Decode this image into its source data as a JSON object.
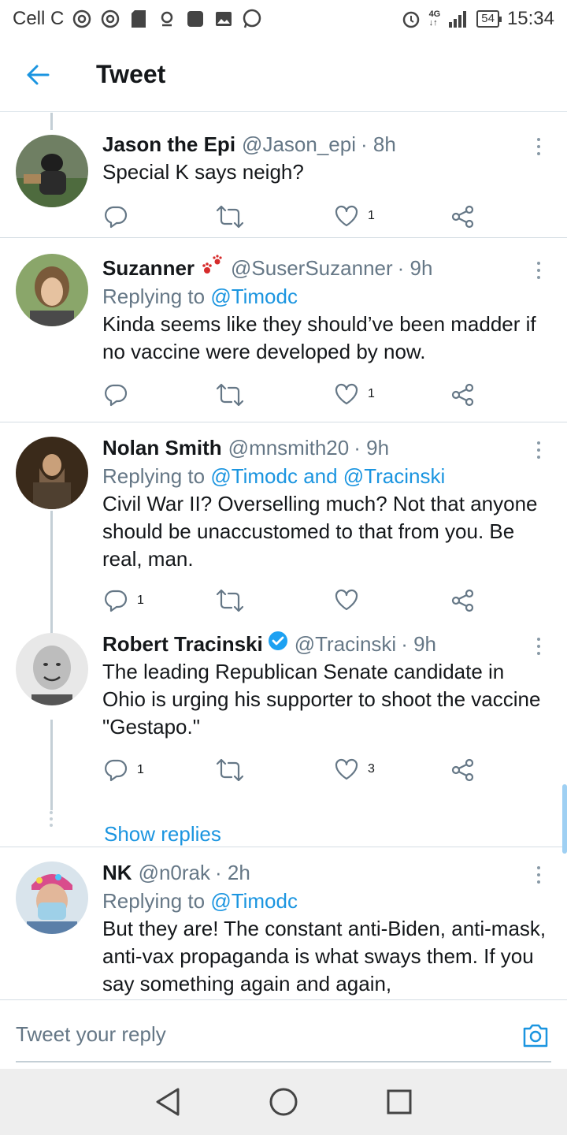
{
  "status_bar": {
    "carrier": "Cell C",
    "network": "4G",
    "battery": "54",
    "time": "15:34",
    "icons": [
      "chrome-icon",
      "chrome-icon",
      "sd-card-icon",
      "location-icon",
      "square-icon",
      "image-icon",
      "whatsapp-icon",
      "alarm-icon",
      "signal-icon"
    ]
  },
  "header": {
    "title": "Tweet",
    "back_icon": "arrow-left-icon"
  },
  "tweets": [
    {
      "name": "Jason the Epi",
      "handle": "@Jason_epi",
      "time": "· 8h",
      "text": "Special K says neigh?",
      "replies": "",
      "likes": "1"
    },
    {
      "name": "Suzanner",
      "name_emoji": "paw-prints-icon",
      "handle": "@SuserSuzanner",
      "time": "· 9h",
      "replying_label": "Replying to",
      "replying_to": "@Timodc",
      "text": "Kinda seems like they should’ve been madder if no vaccine were developed by now.",
      "replies": "",
      "likes": "1"
    },
    {
      "name": "Nolan Smith",
      "handle": "@mnsmith20",
      "time": "· 9h",
      "replying_label": "Replying to",
      "replying_to": "@Timodc and @Tracinski",
      "text": "Civil War II?  Overselling much?  Not that anyone should be unaccustomed to that from you. Be real, man.",
      "replies": "1",
      "likes": ""
    },
    {
      "name": "Robert Tracinski",
      "verified": true,
      "handle": "@Tracinski",
      "time": "· 9h",
      "text": "The leading Republican Senate candidate in Ohio is urging his supporter to shoot the vaccine \"Gestapo.\"",
      "replies": "1",
      "likes": "3",
      "show_replies": "Show replies"
    },
    {
      "name": "NK",
      "handle": "@n0rak",
      "time": "· 2h",
      "replying_label": "Replying to",
      "replying_to": "@Timodc",
      "text": "But they are! The constant anti-Biden, anti-mask, anti-vax propaganda is what sways them. If you say something again and again,"
    }
  ],
  "reply_bar": {
    "placeholder": "Tweet your reply",
    "camera_icon": "camera-icon"
  },
  "nav_bar": {
    "icons": [
      "back-triangle-icon",
      "home-circle-icon",
      "recents-square-icon"
    ]
  },
  "colors": {
    "link": "#1b95e0",
    "muted": "#657786",
    "text": "#14171a"
  }
}
